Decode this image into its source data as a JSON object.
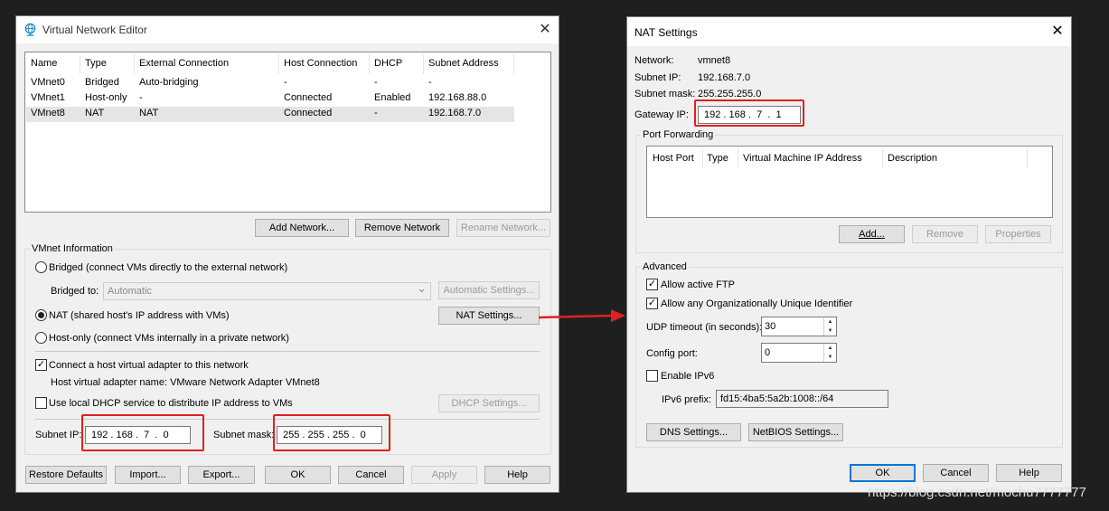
{
  "vne": {
    "title": "Virtual Network Editor",
    "close": "✕",
    "columns": [
      "Name",
      "Type",
      "External Connection",
      "Host Connection",
      "DHCP",
      "Subnet Address"
    ],
    "rows": [
      [
        "VMnet0",
        "Bridged",
        "Auto-bridging",
        "-",
        "-",
        "-"
      ],
      [
        "VMnet1",
        "Host-only",
        "-",
        "Connected",
        "Enabled",
        "192.168.88.0"
      ],
      [
        "VMnet8",
        "NAT",
        "NAT",
        "Connected",
        "-",
        "192.168.7.0"
      ]
    ],
    "add_network": "Add Network...",
    "remove_network": "Remove Network",
    "rename_network": "Rename Network...",
    "group_title": "VMnet Information",
    "bridged_radio": "Bridged (connect VMs directly to the external network)",
    "bridged_to_label": "Bridged to:",
    "bridged_to_value": "Automatic",
    "automatic_settings": "Automatic Settings...",
    "nat_radio": "NAT (shared host's IP address with VMs)",
    "nat_settings": "NAT Settings...",
    "hostonly_radio": "Host-only (connect VMs internally in a private network)",
    "connect_adapter": "Connect a host virtual adapter to this network",
    "adapter_name": "Host virtual adapter name: VMware Network Adapter VMnet8",
    "use_dhcp": "Use local DHCP service to distribute IP address to VMs",
    "dhcp_settings": "DHCP Settings...",
    "subnet_ip_label": "Subnet IP:",
    "subnet_ip_value": "192 . 168 .  7  .  0",
    "subnet_mask_label": "Subnet mask:",
    "subnet_mask_value": "255 . 255 . 255 .  0",
    "restore_defaults": "Restore Defaults",
    "import": "Import...",
    "export": "Export...",
    "ok": "OK",
    "cancel": "Cancel",
    "apply": "Apply",
    "help": "Help"
  },
  "nat": {
    "title": "NAT Settings",
    "close": "✕",
    "network_label": "Network:",
    "network_value": "vmnet8",
    "subnet_ip_label": "Subnet IP:",
    "subnet_ip_value": "192.168.7.0",
    "subnet_mask_label": "Subnet mask:",
    "subnet_mask_value": "255.255.255.0",
    "gateway_label": "Gateway IP:",
    "gateway_value": "192 . 168 .  7  .  1",
    "port_forwarding": "Port Forwarding",
    "pf_columns": [
      "Host Port",
      "Type",
      "Virtual Machine IP Address",
      "Description"
    ],
    "add": "Add...",
    "remove": "Remove",
    "properties": "Properties",
    "advanced": "Advanced",
    "allow_ftp": "Allow active FTP",
    "allow_oui": "Allow any Organizationally Unique Identifier",
    "udp_timeout_label": "UDP timeout (in seconds):",
    "udp_timeout_value": "30",
    "config_port_label": "Config port:",
    "config_port_value": "0",
    "enable_ipv6": "Enable IPv6",
    "ipv6_prefix_label": "IPv6 prefix:",
    "ipv6_prefix_value": "fd15:4ba5:5a2b:1008::/64",
    "dns_settings": "DNS Settings...",
    "netbios_settings": "NetBIOS Settings...",
    "ok": "OK",
    "cancel": "Cancel",
    "help": "Help"
  },
  "check_mark": "✓",
  "spin_up": "▲",
  "spin_down": "▼",
  "combo_arrow": "⌄",
  "watermark": "https://blog.csdn.net/mochu7777777",
  "colors": {
    "highlight": "#e02020",
    "accent": "#0078d7"
  }
}
